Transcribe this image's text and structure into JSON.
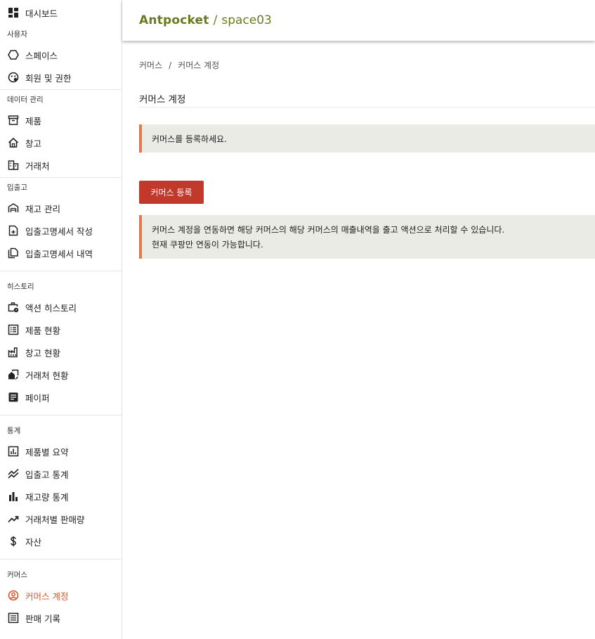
{
  "header": {
    "brand": "Antpocket",
    "separator": "/",
    "space": "space03"
  },
  "sidebar": {
    "dashboard": "대시보드",
    "sections": {
      "users": "사용자",
      "data": "데이터 관리",
      "inout": "입출고",
      "history": "히스토리",
      "stats": "통계",
      "commerce": "커머스"
    },
    "items": {
      "spaces": "스페이스",
      "members": "회원 및 권한",
      "products": "제품",
      "warehouses": "창고",
      "partners": "거래처",
      "stock": "재고 관리",
      "doc_create": "입출고명세서 작성",
      "doc_list": "입출고명세서 내역",
      "action_history": "액션 히스토리",
      "product_status": "제품 현황",
      "warehouse_status": "창고 현황",
      "partner_status": "거래처 현황",
      "paper": "페이퍼",
      "product_summary": "제품별 요약",
      "inout_stats": "입출고 통계",
      "stock_stats": "재고량 통계",
      "partner_sales": "거래처별 판매량",
      "assets": "자산",
      "commerce_account": "커머스 계정",
      "sales_log": "판매 기록"
    }
  },
  "main": {
    "breadcrumb": {
      "parent": "커머스",
      "sep": "/",
      "current": "커머스 계정"
    },
    "title": "커머스 계정",
    "notice1": "커머스를 등록하세요.",
    "register_button": "커머스 등록",
    "notice2_line1": "커머스 계정을 연동하면 해당 커머스의 해당 커머스의 매출내역을 출고 액션으로 처리할 수 있습니다.",
    "notice2_line2": "현재 쿠팡만 연동이 가능합니다."
  },
  "colors": {
    "brand": "#6b7a20",
    "accent": "#d8552a",
    "button": "#c0392b",
    "notice_bg": "#e9ebe4",
    "notice_border": "#e07a4a"
  }
}
